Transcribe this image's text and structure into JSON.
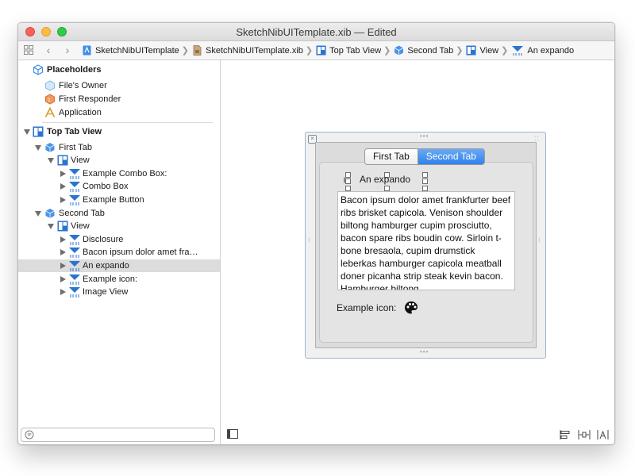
{
  "window": {
    "title": "SketchNibUITemplate.xib — Edited"
  },
  "jumpbar": {
    "crumbs": [
      {
        "label": "SketchNibUITemplate",
        "icon": "project-icon"
      },
      {
        "label": "SketchNibUITemplate.xib",
        "icon": "xib-file-icon"
      },
      {
        "label": "Top Tab View",
        "icon": "view-icon"
      },
      {
        "label": "Second Tab",
        "icon": "cube-icon"
      },
      {
        "label": "View",
        "icon": "view-icon"
      },
      {
        "label": "An expando",
        "icon": "custom-view-icon"
      }
    ]
  },
  "outline": {
    "placeholders_header": "Placeholders",
    "placeholders": [
      "File's Owner",
      "First Responder",
      "Application"
    ],
    "top_tab_view": "Top Tab View",
    "first_tab": "First Tab",
    "first_tab_view": "View",
    "first_tab_items": [
      "Example Combo Box:",
      "Combo Box",
      "Example Button"
    ],
    "second_tab": "Second Tab",
    "second_tab_view": "View",
    "second_tab_items": [
      "Disclosure",
      "Bacon ipsum dolor amet fra…",
      "An expando",
      "Example icon:",
      "Image View"
    ],
    "selected_item": "An expando"
  },
  "canvas": {
    "tabs": [
      "First Tab",
      "Second Tab"
    ],
    "active_tab": "Second Tab",
    "expando_label": "An expando",
    "body_text": "Bacon ipsum dolor amet frankfurter beef ribs brisket capicola. Venison shoulder biltong hamburger cupim prosciutto, bacon spare ribs boudin cow. Sirloin t-bone bresaola, cupim drumstick leberkas hamburger capicola meatball doner picanha strip steak kevin bacon. Hamburger biltong",
    "icon_label": "Example icon:",
    "icon_name": "palette-icon"
  },
  "colors": {
    "selected_tab": "#2f82ea",
    "outline_selection": "#dcdcdc"
  }
}
